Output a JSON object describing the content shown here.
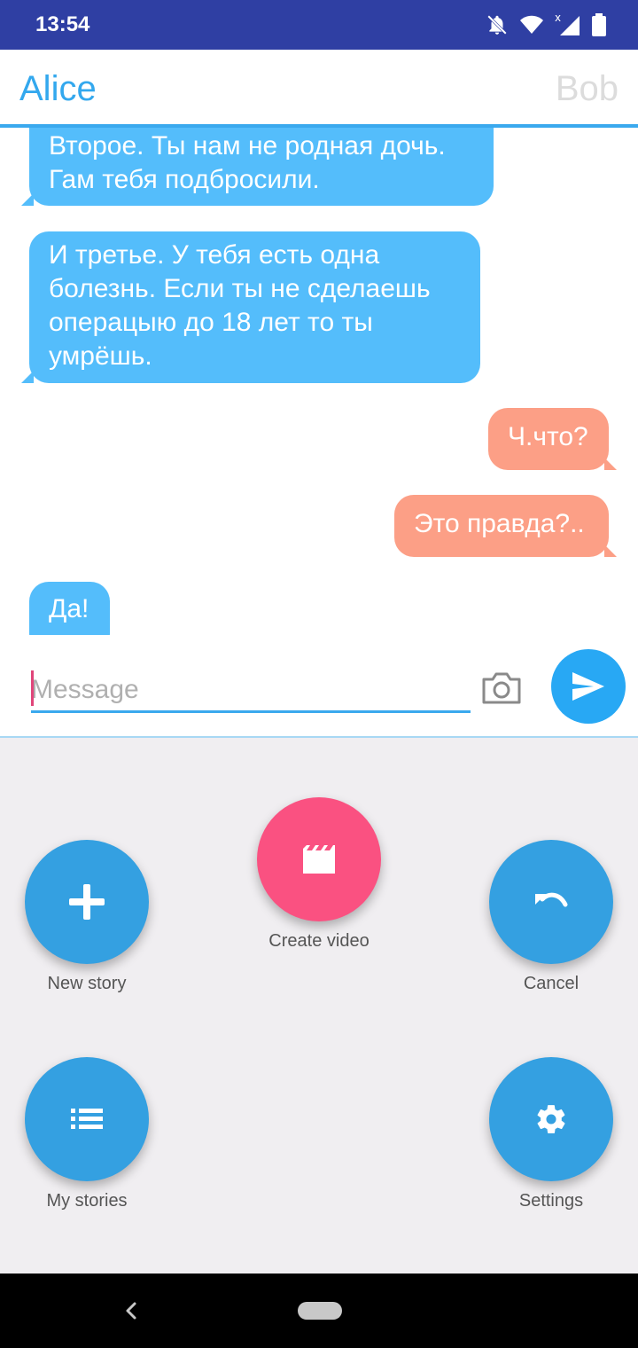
{
  "status_bar": {
    "time": "13:54",
    "icons": [
      "notifications-off-icon",
      "wifi-icon",
      "signal-icon",
      "battery-icon"
    ]
  },
  "header": {
    "left_name": "Alice",
    "right_name": "Bob"
  },
  "messages": [
    {
      "side": "incoming",
      "text_lines": [
        "Второе. Ты нам не родная дочь.",
        "Гам тебя подбросили."
      ]
    },
    {
      "side": "incoming",
      "text_lines": [
        "И третье. У тебя есть одна",
        "болезнь. Если ты не сделаешь",
        "операцыю до 18 лет то ты",
        "умрёшь."
      ]
    },
    {
      "side": "outgoing",
      "text_lines": [
        "Ч.что?"
      ]
    },
    {
      "side": "outgoing",
      "text_lines": [
        "Это правда?.."
      ]
    },
    {
      "side": "incoming",
      "text_lines": [
        "Да!"
      ]
    }
  ],
  "composer": {
    "placeholder": "Message",
    "value": "",
    "camera_icon": "camera-icon",
    "send_icon": "send-icon"
  },
  "actions": [
    {
      "label": "New story",
      "icon": "plus-icon"
    },
    {
      "label": "Create video",
      "icon": "clapperboard-icon"
    },
    {
      "label": "Cancel",
      "icon": "undo-icon"
    },
    {
      "label": "My stories",
      "icon": "list-icon"
    },
    {
      "label": "Settings",
      "icon": "gear-icon"
    }
  ],
  "colors": {
    "incoming_bubble": "#54bdfb",
    "outgoing_bubble": "#fc9f86",
    "accent": "#33a8ee",
    "fab_blue": "#34a0e1",
    "fab_pink": "#fa5181",
    "status_bar": "#2f3fa3"
  }
}
